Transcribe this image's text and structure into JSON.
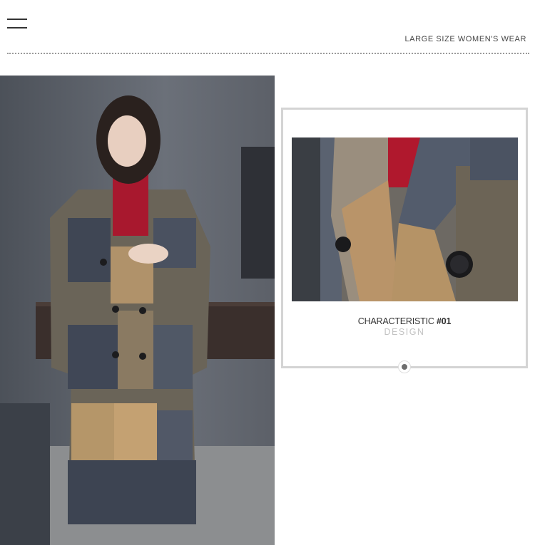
{
  "header": {
    "menu_icon": "hamburger-menu-icon",
    "tagline": "LARGE SIZE WOMEN'S WEAR"
  },
  "feature": {
    "title_prefix": "CHARACTERISTIC ",
    "title_number": "#01",
    "subtitle": "DESIGN"
  },
  "colors": {
    "accent_dark": "#333333",
    "subtitle_gray": "#c2c2c2",
    "frame_border": "#d4d4d4"
  }
}
